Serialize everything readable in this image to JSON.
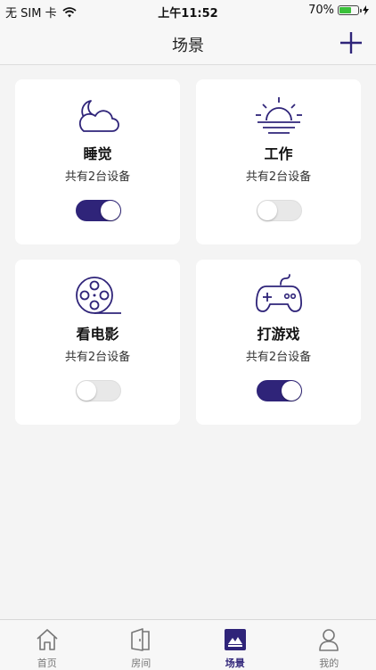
{
  "status_bar": {
    "carrier": "无 SIM 卡",
    "time": "上午11:52",
    "battery": "70%",
    "battery_level": 0.7
  },
  "header": {
    "title": "场景",
    "add_icon": "plus-icon"
  },
  "colors": {
    "accent": "#2f2479",
    "toggle_off": "#e8e8e8",
    "background": "#f4f4f4"
  },
  "scenes": [
    {
      "name": "睡觉",
      "subtitle": "共有2台设备",
      "icon": "moon-cloud-icon",
      "enabled": true
    },
    {
      "name": "工作",
      "subtitle": "共有2台设备",
      "icon": "sunrise-icon",
      "enabled": false
    },
    {
      "name": "看电影",
      "subtitle": "共有2台设备",
      "icon": "film-reel-icon",
      "enabled": false
    },
    {
      "name": "打游戏",
      "subtitle": "共有2台设备",
      "icon": "gamepad-icon",
      "enabled": true
    }
  ],
  "tabs": [
    {
      "label": "首页",
      "icon": "home-icon",
      "active": false
    },
    {
      "label": "房间",
      "icon": "door-icon",
      "active": false
    },
    {
      "label": "场景",
      "icon": "scene-icon",
      "active": true
    },
    {
      "label": "我的",
      "icon": "person-icon",
      "active": false
    }
  ]
}
